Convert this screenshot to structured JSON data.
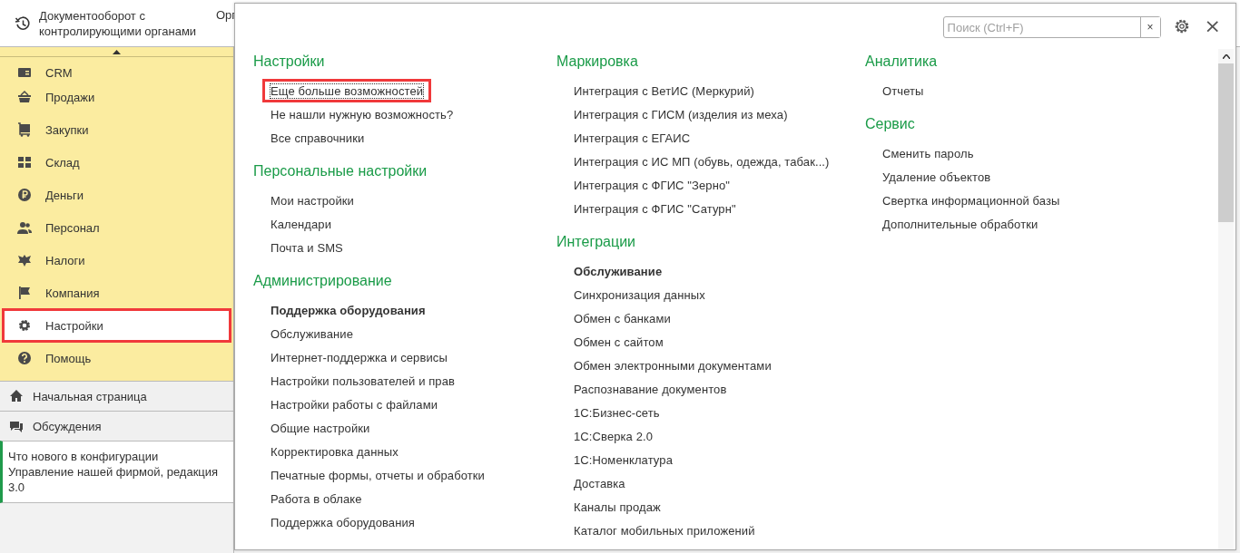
{
  "header": {
    "title": "Документооборот с контролирующими органами",
    "next_title": "Орг"
  },
  "sidebar": {
    "items": [
      {
        "label": "CRM",
        "selected": false,
        "highlighted": false
      },
      {
        "label": "Продажи",
        "selected": false,
        "highlighted": false
      },
      {
        "label": "Закупки",
        "selected": false,
        "highlighted": false
      },
      {
        "label": "Склад",
        "selected": false,
        "highlighted": false
      },
      {
        "label": "Деньги",
        "selected": false,
        "highlighted": false
      },
      {
        "label": "Персонал",
        "selected": false,
        "highlighted": false
      },
      {
        "label": "Налоги",
        "selected": false,
        "highlighted": false
      },
      {
        "label": "Компания",
        "selected": false,
        "highlighted": false
      },
      {
        "label": "Настройки",
        "selected": true,
        "highlighted": true
      },
      {
        "label": "Помощь",
        "selected": false,
        "highlighted": false
      }
    ],
    "links": [
      {
        "label": "Начальная страница"
      },
      {
        "label": "Обсуждения"
      }
    ],
    "news": "Что нового в конфигурации Управление нашей фирмой, редакция 3.0"
  },
  "panel": {
    "search": {
      "placeholder": "Поиск (Ctrl+F)",
      "clear": "×"
    },
    "close": "×",
    "columns": [
      [
        {
          "title": "Настройки",
          "items": [
            {
              "label": "Еще больше возможностей",
              "bold": false,
              "focused": true,
              "highlighted": true
            },
            {
              "label": "Не нашли нужную возможность?",
              "bold": false,
              "focused": false,
              "highlighted": false
            },
            {
              "label": "Все справочники",
              "bold": false,
              "focused": false,
              "highlighted": false
            }
          ]
        },
        {
          "title": "Персональные настройки",
          "items": [
            {
              "label": "Мои настройки",
              "bold": false,
              "focused": false,
              "highlighted": false
            },
            {
              "label": "Календари",
              "bold": false,
              "focused": false,
              "highlighted": false
            },
            {
              "label": "Почта и SMS",
              "bold": false,
              "focused": false,
              "highlighted": false
            }
          ]
        },
        {
          "title": "Администрирование",
          "items": [
            {
              "label": "Поддержка оборудования",
              "bold": true,
              "focused": false,
              "highlighted": false
            },
            {
              "label": "Обслуживание",
              "bold": false,
              "focused": false,
              "highlighted": false
            },
            {
              "label": "Интернет-поддержка и сервисы",
              "bold": false,
              "focused": false,
              "highlighted": false
            },
            {
              "label": "Настройки пользователей и прав",
              "bold": false,
              "focused": false,
              "highlighted": false
            },
            {
              "label": "Настройки работы с файлами",
              "bold": false,
              "focused": false,
              "highlighted": false
            },
            {
              "label": "Общие настройки",
              "bold": false,
              "focused": false,
              "highlighted": false
            },
            {
              "label": "Корректировка данных",
              "bold": false,
              "focused": false,
              "highlighted": false
            },
            {
              "label": "Печатные формы, отчеты и обработки",
              "bold": false,
              "focused": false,
              "highlighted": false
            },
            {
              "label": "Работа в облаке",
              "bold": false,
              "focused": false,
              "highlighted": false
            },
            {
              "label": "Поддержка оборудования",
              "bold": false,
              "focused": false,
              "highlighted": false
            }
          ]
        }
      ],
      [
        {
          "title": "Маркировка",
          "items": [
            {
              "label": "Интеграция с ВетИС (Меркурий)",
              "bold": false,
              "focused": false,
              "highlighted": false
            },
            {
              "label": "Интеграция с ГИСМ (изделия из меха)",
              "bold": false,
              "focused": false,
              "highlighted": false
            },
            {
              "label": "Интеграция с ЕГАИС",
              "bold": false,
              "focused": false,
              "highlighted": false
            },
            {
              "label": "Интеграция с ИС МП (обувь, одежда, табак...)",
              "bold": false,
              "focused": false,
              "highlighted": false
            },
            {
              "label": "Интеграция с ФГИС \"Зерно\"",
              "bold": false,
              "focused": false,
              "highlighted": false
            },
            {
              "label": "Интеграция с ФГИС \"Сатурн\"",
              "bold": false,
              "focused": false,
              "highlighted": false
            }
          ]
        },
        {
          "title": "Интеграции",
          "items": [
            {
              "label": "Обслуживание",
              "bold": true,
              "focused": false,
              "highlighted": false
            },
            {
              "label": "Синхронизация данных",
              "bold": false,
              "focused": false,
              "highlighted": false
            },
            {
              "label": "Обмен с банками",
              "bold": false,
              "focused": false,
              "highlighted": false
            },
            {
              "label": "Обмен с сайтом",
              "bold": false,
              "focused": false,
              "highlighted": false
            },
            {
              "label": "Обмен электронными документами",
              "bold": false,
              "focused": false,
              "highlighted": false
            },
            {
              "label": "Распознавание документов",
              "bold": false,
              "focused": false,
              "highlighted": false
            },
            {
              "label": "1С:Бизнес-сеть",
              "bold": false,
              "focused": false,
              "highlighted": false
            },
            {
              "label": "1С:Сверка 2.0",
              "bold": false,
              "focused": false,
              "highlighted": false
            },
            {
              "label": "1С:Номенклатура",
              "bold": false,
              "focused": false,
              "highlighted": false
            },
            {
              "label": "Доставка",
              "bold": false,
              "focused": false,
              "highlighted": false
            },
            {
              "label": "Каналы продаж",
              "bold": false,
              "focused": false,
              "highlighted": false
            },
            {
              "label": "Каталог мобильных приложений",
              "bold": false,
              "focused": false,
              "highlighted": false
            }
          ]
        }
      ],
      [
        {
          "title": "Аналитика",
          "items": [
            {
              "label": "Отчеты",
              "bold": false,
              "focused": false,
              "highlighted": false
            }
          ]
        },
        {
          "title": "Сервис",
          "items": [
            {
              "label": "Сменить пароль",
              "bold": false,
              "focused": false,
              "highlighted": false
            },
            {
              "label": "Удаление объектов",
              "bold": false,
              "focused": false,
              "highlighted": false
            },
            {
              "label": "Свертка информационной базы",
              "bold": false,
              "focused": false,
              "highlighted": false
            },
            {
              "label": "Дополнительные обработки",
              "bold": false,
              "focused": false,
              "highlighted": false
            }
          ]
        }
      ]
    ]
  }
}
